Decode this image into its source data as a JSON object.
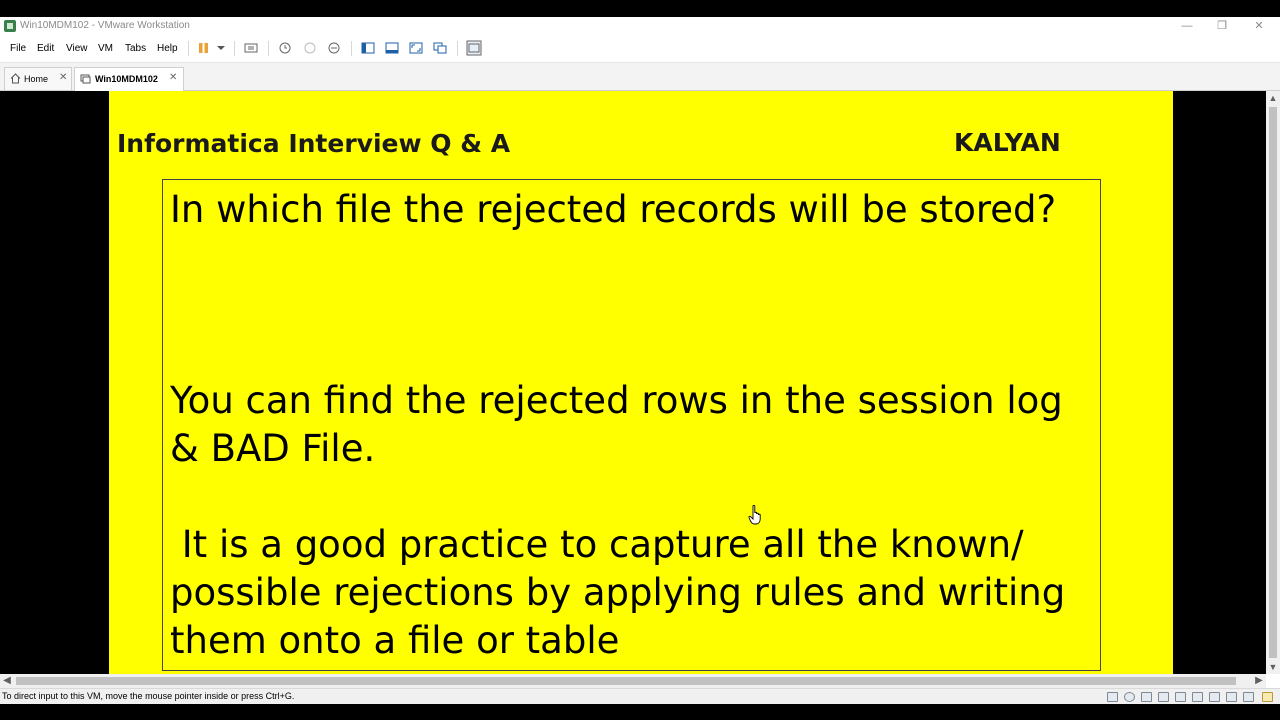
{
  "window": {
    "title": "Win10MDM102 - VMware Workstation",
    "controls": {
      "minimize": "—",
      "restore": "❐",
      "close": "✕"
    }
  },
  "menu": [
    "File",
    "Edit",
    "View",
    "VM",
    "Tabs",
    "Help"
  ],
  "tabs": [
    {
      "label": "Home",
      "icon": "home-icon",
      "active": false
    },
    {
      "label": "Win10MDM102",
      "icon": "vm-icon",
      "active": true
    }
  ],
  "slide": {
    "title": "Informatica Interview Q & A",
    "author": "KALYAN",
    "question": "In which file the rejected records will be stored?",
    "answer": "You can find the rejected rows in the session log & BAD File.",
    "note": " It is a good practice to capture all the known/ possible rejections by applying rules and writing them onto a file or table",
    "background_color": "#ffff00"
  },
  "status": {
    "message": "To direct input to this VM, move the mouse pointer inside or press Ctrl+G.",
    "icons": [
      "hdd-icon",
      "cd-icon",
      "network-icon",
      "printer-icon",
      "usb-icon",
      "sound-icon",
      "display-icon",
      "usb-icon",
      "usb-icon",
      "message-icon"
    ]
  },
  "colors": {
    "pause_accent": "#e8a23a",
    "accent_blue": "#1f5fa8"
  }
}
